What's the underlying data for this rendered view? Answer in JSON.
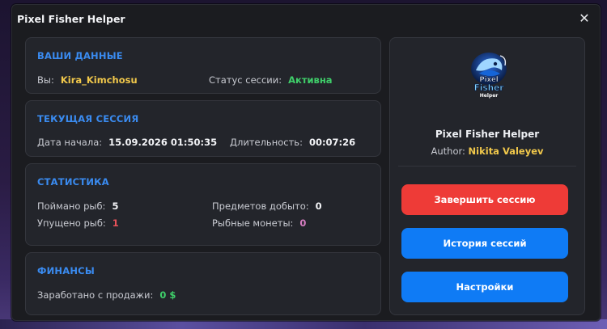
{
  "window": {
    "title": "Pixel Fisher Helper",
    "close_icon": "close-icon"
  },
  "user_card": {
    "title": "ВАШИ ДАННЫЕ",
    "you_label": "Вы:",
    "you_value": "Kira_Kimchosu",
    "status_label": "Статус сессии:",
    "status_value": "Активна"
  },
  "session_card": {
    "title": "ТЕКУЩАЯ СЕССИЯ",
    "start_label": "Дата начала:",
    "start_value": "15.09.2026 01:50:35",
    "duration_label": "Длительность:",
    "duration_value": "00:07:26"
  },
  "stats_card": {
    "title": "СТАТИСТИКА",
    "caught_label": "Поймано рыб:",
    "caught_value": "5",
    "missed_label": "Упущено рыб:",
    "missed_value": "1",
    "items_label": "Предметов добыто:",
    "items_value": "0",
    "coins_label": "Рыбные монеты:",
    "coins_value": "0"
  },
  "finance_card": {
    "title": "ФИНАНСЫ",
    "earned_label": "Заработано с продажи:",
    "earned_value": "0 $"
  },
  "about": {
    "logo_text": [
      "Pixel",
      "Fisher",
      "Helper"
    ],
    "app_name": "Pixel Fisher Helper",
    "author_label": "Author:",
    "author_name": "Nikita Valeyev"
  },
  "actions": {
    "end_session": "Завершить сессию",
    "history": "История сессий",
    "settings": "Настройки"
  },
  "colors": {
    "accent_blue": "#0f7bf5",
    "danger_red": "#ee3b37",
    "section_title": "#3a8bf0",
    "highlight_yellow": "#f1c84b",
    "active_green": "#3fcf6a"
  }
}
